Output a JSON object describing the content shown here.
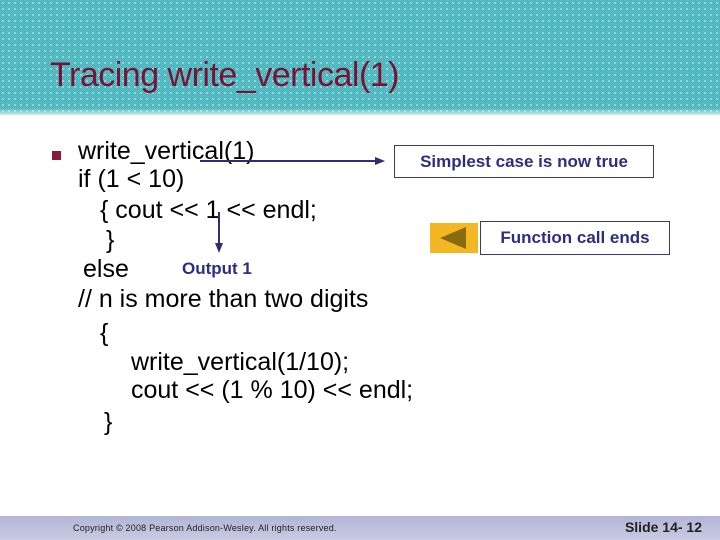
{
  "slide": {
    "title": "Tracing write_vertical(1)",
    "code_lines": [
      "write_vertical(1)",
      "if (1 < 10)",
      "{ cout << 1 << endl;",
      "}",
      "else",
      "// n is more than two digits",
      "{",
      "write_vertical(1/10);",
      "cout << (1 % 10) << endl;",
      "}"
    ],
    "callouts": {
      "simplest_case": "Simplest case is now true",
      "function_call_ends": "Function call ends",
      "output": "Output 1"
    },
    "icons": {
      "bullet": "square-bullet",
      "back_button": "triangle-left-icon"
    },
    "colors": {
      "title": "#7a1236",
      "callout_text": "#2e2e80",
      "button_bg": "#f2b722",
      "header_bg": "#5fc3c9"
    }
  },
  "footer": {
    "copyright": "Copyright © 2008 Pearson Addison-Wesley. All rights reserved.",
    "slide_number": "Slide 14- 12"
  }
}
